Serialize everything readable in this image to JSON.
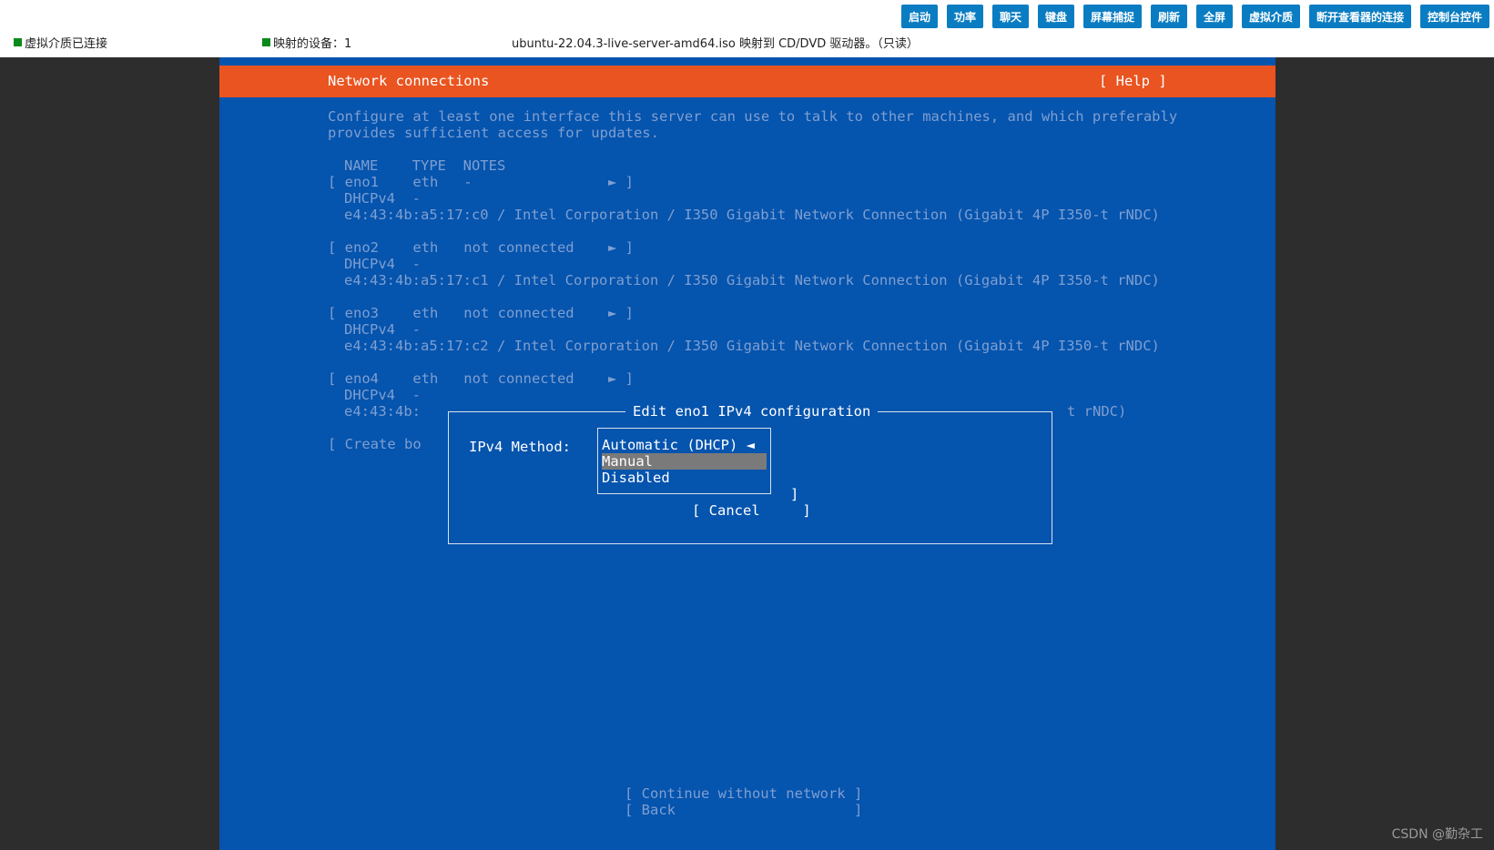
{
  "toolbar": {
    "buttons": [
      "启动",
      "功率",
      "聊天",
      "键盘",
      "屏幕捕捉",
      "刷新",
      "全屏",
      "虚拟介质",
      "断开查看器的连接",
      "控制台控件"
    ]
  },
  "status": {
    "media": "虚拟介质已连接",
    "mapped": "映射的设备：1",
    "iso": "ubuntu-22.04.3-live-server-amd64.iso 映射到 CD/DVD 驱动器。（只读）"
  },
  "console": {
    "title": "Network connections",
    "help": "[ Help ]",
    "intro_line1": "Configure at least one interface this server can use to talk to other machines, and which preferably",
    "intro_line2": "provides sufficient access for updates.",
    "columns": "NAME    TYPE  NOTES",
    "interfaces": [
      {
        "row": "[ eno1    eth   -                ► ]",
        "dhcp": "DHCPv4  -",
        "mac": "e4:43:4b:a5:17:c0 / Intel Corporation / I350 Gigabit Network Connection (Gigabit 4P I350-t rNDC)"
      },
      {
        "row": "[ eno2    eth   not connected    ► ]",
        "dhcp": "DHCPv4  -",
        "mac": "e4:43:4b:a5:17:c1 / Intel Corporation / I350 Gigabit Network Connection (Gigabit 4P I350-t rNDC)"
      },
      {
        "row": "[ eno3    eth   not connected    ► ]",
        "dhcp": "DHCPv4  -",
        "mac": "e4:43:4b:a5:17:c2 / Intel Corporation / I350 Gigabit Network Connection (Gigabit 4P I350-t rNDC)"
      },
      {
        "row": "[ eno4    eth   not connected    ► ]",
        "dhcp": "DHCPv4  -",
        "mac_visible": "e4:43:4b:",
        "mac_tail": "t rNDC)"
      }
    ],
    "create_bond": "[ Create bo",
    "continue": "[ Continue without network ]",
    "back": "[ Back                     ]"
  },
  "dialog": {
    "title": "Edit eno1 IPv4 configuration",
    "method_label": "IPv4 Method:",
    "options": [
      "Automatic (DHCP) ◄",
      "Manual",
      "Disabled"
    ],
    "selected_option": "Manual",
    "save_bracket": "]",
    "cancel": "[ Cancel     ]"
  },
  "watermark": "CSDN @勤杂工"
}
